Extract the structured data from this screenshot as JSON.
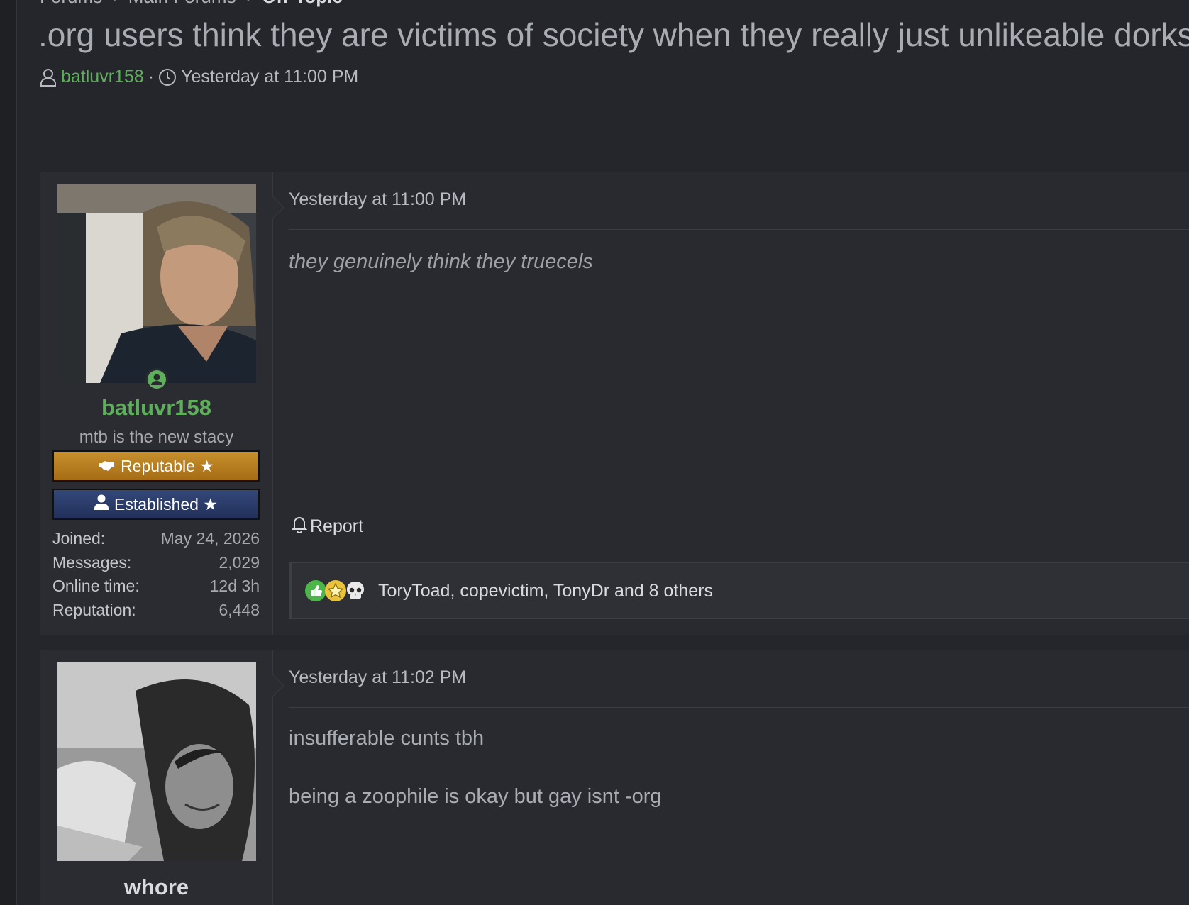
{
  "breadcrumb": {
    "items": [
      "Forums",
      "Main Forums"
    ],
    "current": "Off-Topic"
  },
  "thread": {
    "title": ".org users think they are victims of society when they really just unlikeable dorks",
    "author": "batluvr158",
    "separator": "·",
    "date": "Yesterday at 11:00 PM"
  },
  "posts": [
    {
      "user": {
        "name": "batluvr158",
        "title": "mtb is the new stacy",
        "banners": [
          {
            "label": "Reputable ★",
            "icon": "handshake-icon"
          },
          {
            "label": "Established ★",
            "icon": "user-icon"
          }
        ],
        "stats": [
          {
            "label": "Joined:",
            "value": "May 24, 2026"
          },
          {
            "label": "Messages:",
            "value": "2,029"
          },
          {
            "label": "Online time:",
            "value": "12d 3h"
          },
          {
            "label": "Reputation:",
            "value": "6,448"
          }
        ]
      },
      "date": "Yesterday at 11:00 PM",
      "body": "they genuinely think they truecels",
      "report_label": "Report",
      "reactions": {
        "icons": [
          "thumbs-up-icon",
          "star-icon",
          "skull-icon"
        ],
        "text": "ToryToad, copevictim, TonyDr and 8 others"
      }
    },
    {
      "user": {
        "name": "whore"
      },
      "date": "Yesterday at 11:02 PM",
      "paragraphs": [
        "insufferable cunts tbh",
        "being a zoophile is okay but gay isnt -org"
      ]
    }
  ],
  "colors": {
    "background": "#25262b",
    "username_green": "#5fae5c",
    "reputable_banner": "#b57c1f",
    "established_banner": "#2a3b68"
  }
}
